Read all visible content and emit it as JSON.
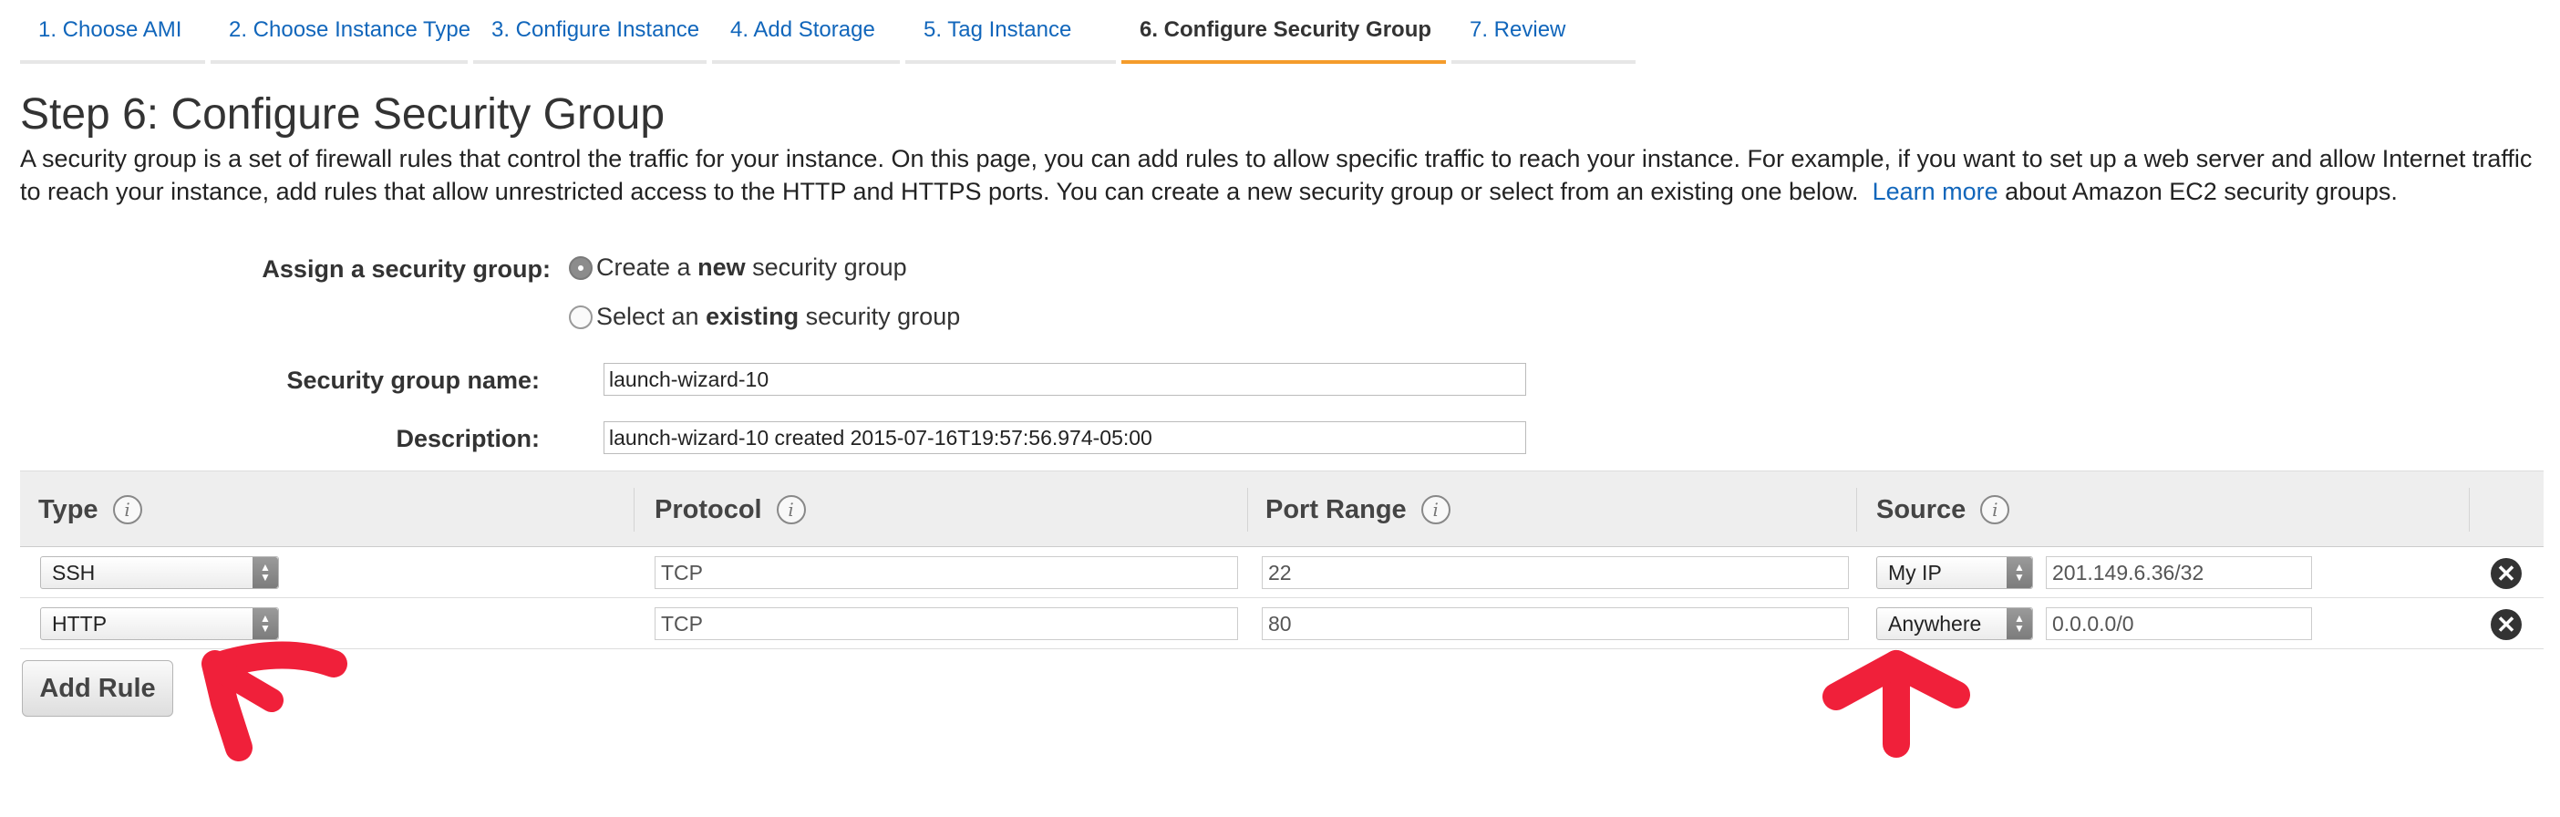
{
  "tabs": [
    {
      "label": "1. Choose AMI"
    },
    {
      "label": "2. Choose Instance Type"
    },
    {
      "label": "3. Configure Instance"
    },
    {
      "label": "4. Add Storage"
    },
    {
      "label": "5. Tag Instance"
    },
    {
      "label": "6. Configure Security Group"
    },
    {
      "label": "7. Review"
    }
  ],
  "page": {
    "title": "Step 6: Configure Security Group",
    "intro_text": "A security group is a set of firewall rules that control the traffic for your instance. On this page, you can add rules to allow specific traffic to reach your instance. For example, if you want to set up a web server and allow Internet traffic to reach your instance, add rules that allow unrestricted access to the HTTP and HTTPS ports. You can create a new security group or select from an existing one below.",
    "learn_more": "Learn more",
    "intro_tail": "about Amazon EC2 security groups."
  },
  "form": {
    "assign_label": "Assign a security group:",
    "option_new_pre": "Create a",
    "option_new_bold": "new",
    "option_new_post": "security group",
    "option_existing_pre": "Select an",
    "option_existing_bold": "existing",
    "option_existing_post": "security group",
    "name_label": "Security group name:",
    "name_value": "launch-wizard-10",
    "desc_label": "Description:",
    "desc_value": "launch-wizard-10 created 2015-07-16T19:57:56.974-05:00"
  },
  "table": {
    "headers": {
      "type": "Type",
      "protocol": "Protocol",
      "port_range": "Port Range",
      "source": "Source"
    },
    "info_glyph": "i",
    "rows": [
      {
        "type": "SSH",
        "protocol": "TCP",
        "port": "22",
        "source": "My IP",
        "cidr": "201.149.6.36/32"
      },
      {
        "type": "HTTP",
        "protocol": "TCP",
        "port": "80",
        "source": "Anywhere",
        "cidr": "0.0.0.0/0"
      }
    ]
  },
  "buttons": {
    "add_rule": "Add Rule",
    "remove_glyph": "✕"
  },
  "colors": {
    "link": "#1166bb",
    "active_tab": "#f49c2c",
    "annotation": "#f0203a"
  }
}
